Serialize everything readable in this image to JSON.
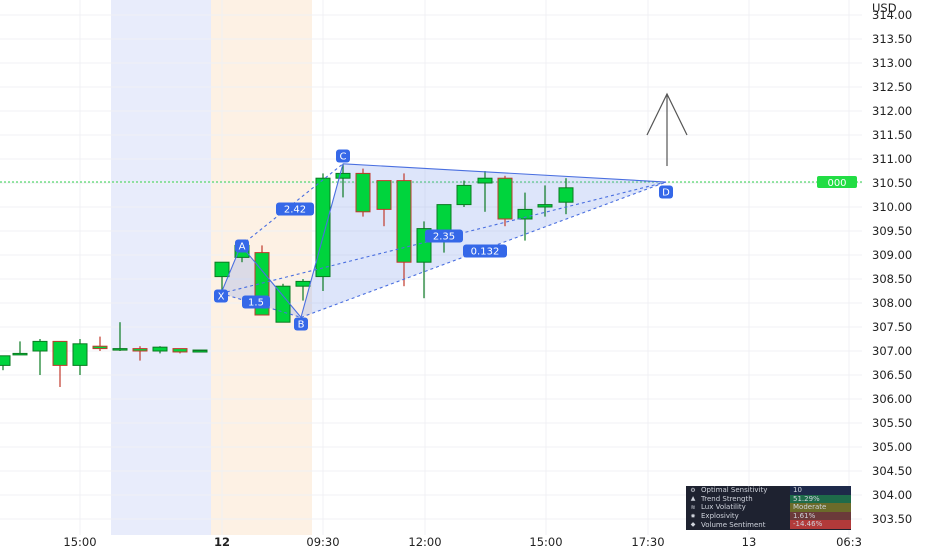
{
  "chart_data": {
    "type": "candlestick",
    "currency": "USD",
    "y_range": [
      303.2,
      314.2
    ],
    "y_ticks": [
      "314.00",
      "313.50",
      "313.00",
      "312.50",
      "312.00",
      "311.50",
      "311.00",
      "310.50",
      "310.00",
      "309.50",
      "309.00",
      "308.50",
      "308.00",
      "307.50",
      "307.00",
      "306.50",
      "306.00",
      "305.50",
      "305.00",
      "304.50",
      "304.00",
      "303.50"
    ],
    "x_ticks": [
      "15:00",
      "12",
      "09:30",
      "12:00",
      "15:00",
      "17:30",
      "13",
      "06:3"
    ],
    "current_price_label": "000",
    "current_price": 310.52,
    "candles": [
      {
        "o": 306.7,
        "h": 306.9,
        "l": 306.6,
        "c": 306.9
      },
      {
        "o": 306.95,
        "h": 307.2,
        "l": 306.95,
        "c": 306.95
      },
      {
        "o": 307.0,
        "h": 307.25,
        "l": 306.5,
        "c": 307.2
      },
      {
        "o": 307.2,
        "h": 307.2,
        "l": 306.25,
        "c": 306.7
      },
      {
        "o": 306.7,
        "h": 307.25,
        "l": 306.5,
        "c": 307.15
      },
      {
        "o": 307.1,
        "h": 307.3,
        "l": 307.0,
        "c": 307.05
      },
      {
        "o": 307.05,
        "h": 307.6,
        "l": 307.0,
        "c": 307.05
      },
      {
        "o": 307.05,
        "h": 307.1,
        "l": 306.8,
        "c": 307.0
      },
      {
        "o": 307.0,
        "h": 307.1,
        "l": 306.95,
        "c": 307.08
      },
      {
        "o": 307.05,
        "h": 307.05,
        "l": 306.95,
        "c": 306.98
      },
      {
        "o": 307.0,
        "h": 307.02,
        "l": 306.99,
        "c": 307.02
      },
      {
        "o": 307.01,
        "h": 307.02,
        "l": 307.0,
        "c": 307.01
      },
      {
        "o": 308.55,
        "h": 308.85,
        "l": 308.2,
        "c": 308.85
      },
      {
        "o": 308.95,
        "h": 309.2,
        "l": 308.85,
        "c": 309.2
      },
      {
        "o": 309.05,
        "h": 309.2,
        "l": 307.75,
        "c": 307.75
      },
      {
        "o": 307.6,
        "h": 308.4,
        "l": 307.6,
        "c": 308.35
      },
      {
        "o": 308.35,
        "h": 308.5,
        "l": 308.05,
        "c": 308.45
      },
      {
        "o": 308.55,
        "h": 310.7,
        "l": 308.25,
        "c": 310.6
      },
      {
        "o": 310.6,
        "h": 310.9,
        "l": 310.2,
        "c": 310.7
      },
      {
        "o": 310.7,
        "h": 310.8,
        "l": 309.8,
        "c": 309.9
      },
      {
        "o": 310.55,
        "h": 310.55,
        "l": 309.6,
        "c": 309.95
      },
      {
        "o": 310.55,
        "h": 310.7,
        "l": 308.35,
        "c": 308.85
      },
      {
        "o": 308.85,
        "h": 309.7,
        "l": 308.1,
        "c": 309.55
      },
      {
        "o": 309.5,
        "h": 310.05,
        "l": 309.05,
        "c": 310.05
      },
      {
        "o": 310.05,
        "h": 310.55,
        "l": 310.0,
        "c": 310.45
      },
      {
        "o": 310.5,
        "h": 310.75,
        "l": 309.9,
        "c": 310.6
      },
      {
        "o": 310.6,
        "h": 310.65,
        "l": 309.6,
        "c": 309.75
      },
      {
        "o": 309.75,
        "h": 310.3,
        "l": 309.3,
        "c": 309.95
      },
      {
        "o": 310.0,
        "h": 310.45,
        "l": 309.8,
        "c": 310.05
      },
      {
        "o": 310.1,
        "h": 310.6,
        "l": 309.85,
        "c": 310.4
      }
    ],
    "pattern": {
      "points": [
        {
          "name": "X",
          "price": 308.2
        },
        {
          "name": "A",
          "price": 309.2
        },
        {
          "name": "B",
          "price": 307.7
        },
        {
          "name": "C",
          "price": 310.9
        },
        {
          "name": "D",
          "price": 310.52
        }
      ],
      "ratio_labels": [
        "2.42",
        "1.5",
        "0.132",
        "2.35"
      ],
      "target_arrow_price": 312.0
    }
  },
  "panel": {
    "rows": [
      {
        "icon": "gear-icon",
        "key": "Optimal Sensitivity",
        "value": "10",
        "color": "#1e2a4a"
      },
      {
        "icon": "trend-icon",
        "key": "Trend Strength",
        "value": "51.29%",
        "color": "#1e6b4a"
      },
      {
        "icon": "volatility-icon",
        "key": "Lux Volatility",
        "value": "Moderate",
        "color": "#6b6b2a"
      },
      {
        "icon": "explosive-icon",
        "key": "Explosivity",
        "value": "1.61%",
        "color": "#6b3a3a"
      },
      {
        "icon": "sentiment-icon",
        "key": "Volume Sentiment",
        "value": "-14.46%",
        "color": "#b23a3a"
      }
    ]
  }
}
